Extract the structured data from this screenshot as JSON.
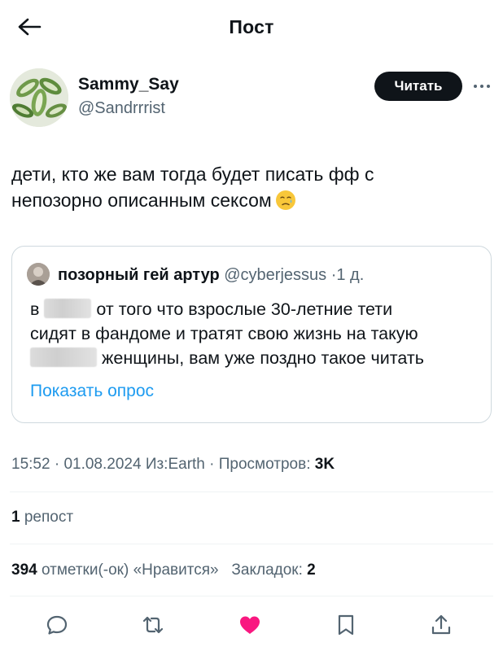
{
  "header": {
    "title": "Пост",
    "back_icon": "arrow-left-icon"
  },
  "author": {
    "name": "Sammy_Say",
    "handle": "@Sandrrrist",
    "follow_label": "Читать",
    "more_icon": "more-horizontal-icon"
  },
  "tweet": {
    "text_line1": "дети, кто же вам тогда будет писать фф с",
    "text_line2": "непозорно описанным сексом",
    "emoji": "face-holding-back-tears-emoji"
  },
  "quote": {
    "name": "позорный гей артур",
    "handle": "@cyberjessus",
    "time": "1 д.",
    "line1_start": "в",
    "line1_end": "от того что взрослые 30-летние тети",
    "line2": "сидят в фандоме и тратят свою жизнь на такую",
    "line3_end": "женщины, вам уже поздно такое читать",
    "poll_label": "Показать опрос"
  },
  "meta": {
    "time": "15:52",
    "date": "01.08.2024",
    "source": "Из:Earth",
    "views_label": "Просмотров:",
    "views_value": "3K"
  },
  "stats": {
    "reposts_value": "1",
    "reposts_label": "репост",
    "likes_value": "394",
    "likes_label": "отметки(-ок) «Нравится»",
    "bookmarks_label": "Закладок:",
    "bookmarks_value": "2"
  },
  "actions": [
    "reply-icon",
    "repost-icon",
    "like-icon",
    "bookmark-icon",
    "share-icon"
  ],
  "colors": {
    "accent": "#1d9bf0",
    "like": "#f91880",
    "text": "#0f1419",
    "secondary": "#536471",
    "border": "#cfd9de"
  }
}
